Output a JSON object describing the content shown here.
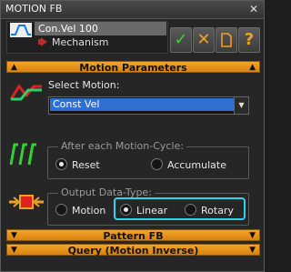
{
  "window": {
    "title": "MOTION FB",
    "close_glyph": "✕"
  },
  "header": {
    "selected_item": "Con.Vel 100",
    "sub_item": "Mechanism"
  },
  "toolbar": {
    "ok_glyph": "✓",
    "cancel_glyph": "✕",
    "doc_glyph": "▯",
    "help_glyph": "?"
  },
  "sections": {
    "motion_parameters": "Motion Parameters",
    "pattern_fb": "Pattern FB",
    "query": "Query (Motion Inverse)"
  },
  "motion": {
    "select_label": "Select Motion:",
    "selected_value": "Const Vel"
  },
  "cycle": {
    "group_label": "After each Motion-Cycle:",
    "options": [
      "Reset",
      "Accumulate"
    ],
    "selected": "Reset"
  },
  "output": {
    "group_label": "Output Data-Type:",
    "options": [
      "Motion",
      "Linear",
      "Rotary"
    ],
    "selected": "Linear"
  },
  "colors": {
    "accent_bar": "#e8951d",
    "selection_blue": "#2f6fd0",
    "highlight": "#2fd3f2",
    "green": "#3ad13a",
    "orange": "#f0a020",
    "red": "#e02020"
  },
  "icons": [
    "motion-curve-icon",
    "arrow-right-icon",
    "checkmark-icon",
    "cancel-icon",
    "document-icon",
    "help-icon",
    "select-motion-icon",
    "cycle-wave-icon",
    "output-type-icon"
  ]
}
